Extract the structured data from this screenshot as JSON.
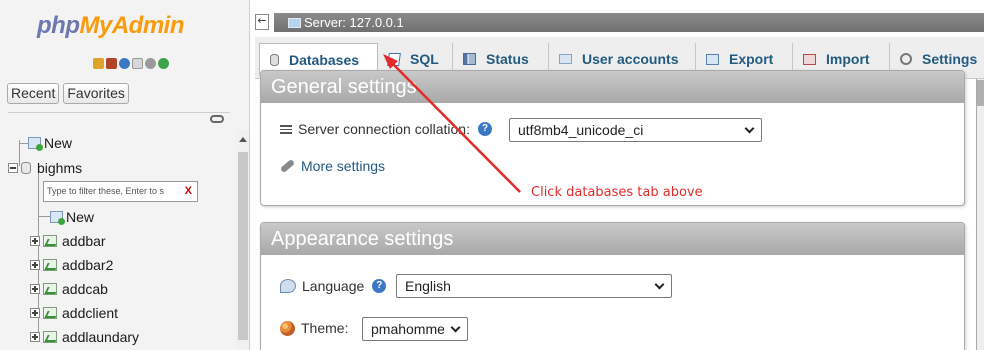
{
  "nav": {
    "logo_part1": "php",
    "logo_part2": "MyAdmin",
    "tabs": [
      "Recent",
      "Favorites"
    ],
    "tree": {
      "new_root": "New",
      "database": "bighms",
      "filter_placeholder": "Type to filter these, Enter to s",
      "filter_clear": "X",
      "new_table": "New",
      "tables": [
        "addbar",
        "addbar2",
        "addcab",
        "addclient",
        "addlaundary"
      ]
    }
  },
  "topbar": {
    "collapse_glyph": "←",
    "server_label": "Server: 127.0.0.1"
  },
  "main_tabs": [
    {
      "label": "Databases",
      "icon": "database-icon"
    },
    {
      "label": "SQL",
      "icon": "sql-icon"
    },
    {
      "label": "Status",
      "icon": "status-icon"
    },
    {
      "label": "User accounts",
      "icon": "user-accounts-icon"
    },
    {
      "label": "Export",
      "icon": "export-icon"
    },
    {
      "label": "Import",
      "icon": "import-icon"
    },
    {
      "label": "Settings",
      "icon": "settings-icon"
    }
  ],
  "general_settings": {
    "title": "General settings",
    "collation_label": "Server connection collation:",
    "collation_value": "utf8mb4_unicode_ci",
    "more_settings": "More settings"
  },
  "annotation": {
    "text": "Click databases tab above",
    "color": "#e32b2b"
  },
  "appearance_settings": {
    "title": "Appearance settings",
    "language_label": "Language",
    "language_value": "English",
    "theme_label": "Theme:",
    "theme_value": "pmahomme"
  }
}
